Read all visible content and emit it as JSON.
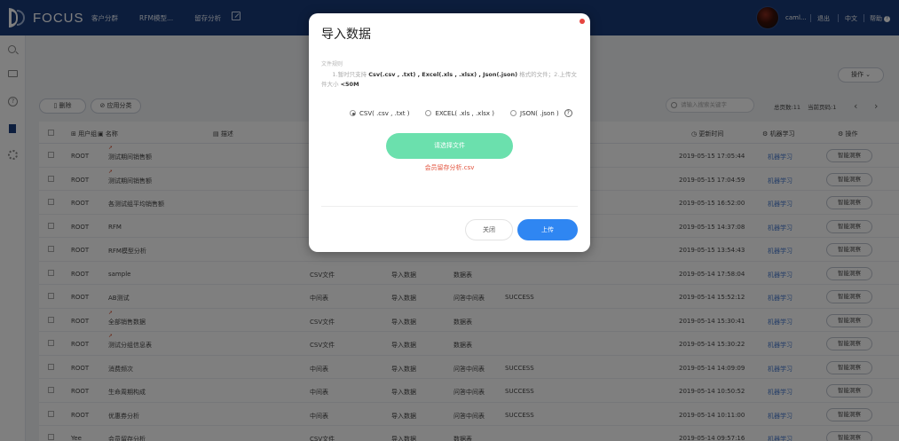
{
  "app": {
    "logo_text": "FOCUS",
    "nav": [
      "客户分群",
      "RFM模型...",
      "留存分析"
    ],
    "user_name": "caml...",
    "logout": "退出",
    "language": "中文",
    "help": "帮助"
  },
  "toolbar": {
    "delete_label": "删除",
    "apply_label": "应用分类",
    "operation_label": "操作",
    "search_placeholder": "请输入搜索关键字",
    "total_count": "总页数:11",
    "current_page": "当前页码:1"
  },
  "table": {
    "headers": {
      "user_group": "用户组",
      "name": "名称",
      "description": "描述",
      "update_time": "更新时间",
      "ml": "机器学习",
      "action": "操作"
    },
    "ml_label": "机器学习",
    "action_label": "智能洞察",
    "rows": [
      {
        "group": "ROOT",
        "name": "测试期间销售额",
        "type": "",
        "source": "",
        "kind": "",
        "status": "",
        "time": "2019-05-15 17:05:44"
      },
      {
        "group": "ROOT",
        "name": "测试期间销售额",
        "type": "",
        "source": "",
        "kind": "",
        "status": "",
        "time": "2019-05-15 17:04:59"
      },
      {
        "group": "ROOT",
        "name": "各测试组平均销售额",
        "type": "",
        "source": "",
        "kind": "",
        "status": "",
        "time": "2019-05-15 16:52:00"
      },
      {
        "group": "ROOT",
        "name": "RFM",
        "type": "",
        "source": "",
        "kind": "",
        "status": "",
        "time": "2019-05-15 14:37:08"
      },
      {
        "group": "ROOT",
        "name": "RFM模型分析",
        "type": "",
        "source": "",
        "kind": "",
        "status": "",
        "time": "2019-05-15 13:54:43"
      },
      {
        "group": "ROOT",
        "name": "sample",
        "type": "CSV文件",
        "source": "导入数据",
        "kind": "数据表",
        "status": "",
        "time": "2019-05-14 17:58:04"
      },
      {
        "group": "ROOT",
        "name": "AB测试",
        "type": "中间表",
        "source": "导入数据",
        "kind": "问答中间表",
        "status": "SUCCESS",
        "time": "2019-05-14 15:52:12"
      },
      {
        "group": "ROOT",
        "name": "全部销售数据",
        "type": "CSV文件",
        "source": "导入数据",
        "kind": "数据表",
        "status": "",
        "time": "2019-05-14 15:30:41"
      },
      {
        "group": "ROOT",
        "name": "测试分组信息表",
        "type": "CSV文件",
        "source": "导入数据",
        "kind": "数据表",
        "status": "",
        "time": "2019-05-14 15:30:22"
      },
      {
        "group": "ROOT",
        "name": "消费频次",
        "type": "中间表",
        "source": "导入数据",
        "kind": "问答中间表",
        "status": "SUCCESS",
        "time": "2019-05-14 14:09:09"
      },
      {
        "group": "ROOT",
        "name": "生命周期构成",
        "type": "中间表",
        "source": "导入数据",
        "kind": "问答中间表",
        "status": "SUCCESS",
        "time": "2019-05-14 10:50:52"
      },
      {
        "group": "ROOT",
        "name": "优惠券分析",
        "type": "中间表",
        "source": "导入数据",
        "kind": "问答中间表",
        "status": "SUCCESS",
        "time": "2019-05-14 10:11:00"
      },
      {
        "group": "Yee",
        "name": "会员留存分析",
        "type": "CSV文件",
        "source": "导入数据",
        "kind": "数据表",
        "status": "",
        "time": "2019-05-14 09:57:16"
      }
    ]
  },
  "modal": {
    "title": "导入数据",
    "tips_label": "文件规则",
    "tip_prefix": "1.暂时只支持",
    "tip_formats": "Csv(.csv , .txt) , Excel(.xls , .xlsx) , Json(.json)",
    "tip_middle": "格式的文件；2.上传文件大小",
    "tip_size": "<50M",
    "radio_options": [
      "CSV( .csv , .txt )",
      "EXCEL( .xls , .xlsx )",
      "JSON( .json )"
    ],
    "selected_radio": "CSV( .csv , .txt )",
    "select_file_label": "请选择文件",
    "selected_file": "会员留存分析.csv",
    "close_label": "关闭",
    "upload_label": "上传"
  },
  "colors": {
    "topbar": "#193a78",
    "select_button": "#6be0ad",
    "upload_button": "#2f86f2",
    "file_name": "#e2513b"
  }
}
